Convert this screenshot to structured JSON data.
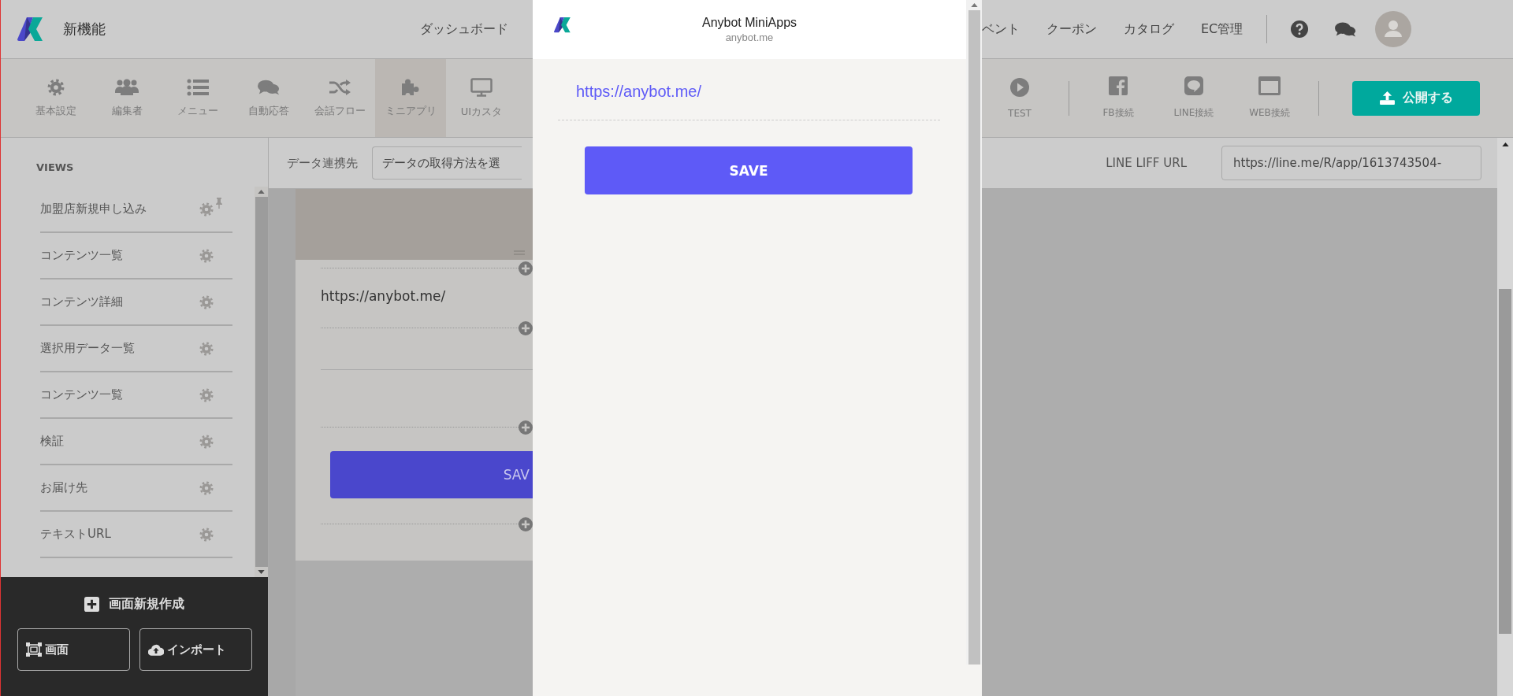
{
  "brand": {
    "title": "新機能"
  },
  "nav": {
    "left": [
      {
        "label": "ダッシュボード"
      }
    ],
    "right": [
      {
        "label": "ベント"
      },
      {
        "label": "クーポン"
      },
      {
        "label": "カタログ"
      },
      {
        "label": "EC管理"
      }
    ]
  },
  "toolbar": {
    "tools": [
      {
        "label": "基本設定",
        "selected": false
      },
      {
        "label": "編集者",
        "selected": false
      },
      {
        "label": "メニュー",
        "selected": false
      },
      {
        "label": "自動応答",
        "selected": false
      },
      {
        "label": "会話フロー",
        "selected": false
      },
      {
        "label": "ミニアプリ",
        "selected": true
      },
      {
        "label": "UIカスタ",
        "selected": false
      }
    ],
    "connections": [
      {
        "label": "TEST"
      },
      {
        "label": "FB接続"
      },
      {
        "label": "LINE接続"
      },
      {
        "label": "WEB接続"
      }
    ],
    "publish_button": "公開する"
  },
  "sidebar": {
    "heading": "VIEWS",
    "items": [
      {
        "label": "加盟店新規申し込み",
        "pinned": true
      },
      {
        "label": "コンテンツ一覧",
        "pinned": false
      },
      {
        "label": "コンテンツ詳細",
        "pinned": false
      },
      {
        "label": "選択用データ一覧",
        "pinned": false
      },
      {
        "label": "コンテンツ一覧",
        "pinned": false
      },
      {
        "label": "検証",
        "pinned": false
      },
      {
        "label": "お届け先",
        "pinned": false
      },
      {
        "label": "テキストURL",
        "pinned": false
      }
    ],
    "create_button": "画面新規作成",
    "buttons": [
      {
        "label": "画面",
        "kind": "screen"
      },
      {
        "label": "インポート",
        "kind": "import"
      }
    ]
  },
  "content": {
    "data_source_label": "データ連携先",
    "data_source_select": "データの取得方法を選",
    "liff_label": "LINE LIFF URL",
    "liff_url": "https://line.me/R/app/1613743504-"
  },
  "preview": {
    "url_text": "https://anybot.me/",
    "save_button": "SAV"
  },
  "popup": {
    "title": "Anybot MiniApps",
    "domain": "anybot.me",
    "link": "https://anybot.me/",
    "save_button": "SAVE"
  }
}
